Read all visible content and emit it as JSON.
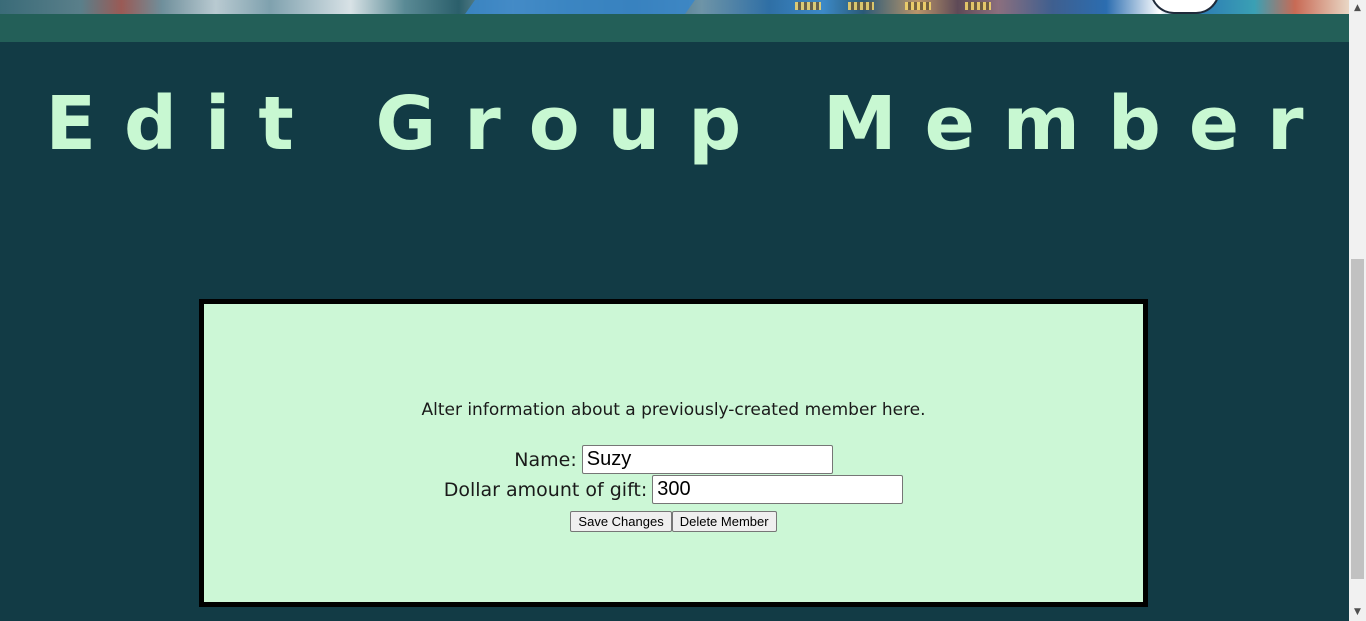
{
  "page": {
    "title": "Edit Group Member"
  },
  "form": {
    "intro": "Alter information about a previously-created member here.",
    "name_label": "Name:",
    "name_value": "Suzy",
    "gift_label": "Dollar amount of gift:",
    "gift_value": "300",
    "save_label": "Save Changes",
    "delete_label": "Delete Member"
  },
  "scrollbar": {
    "up_icon": "▲",
    "down_icon": "▼"
  },
  "colors": {
    "background": "#123b45",
    "strip": "#235f58",
    "title": "#c8f8d2",
    "card": "#ccf7d6",
    "card_border": "#000000"
  }
}
